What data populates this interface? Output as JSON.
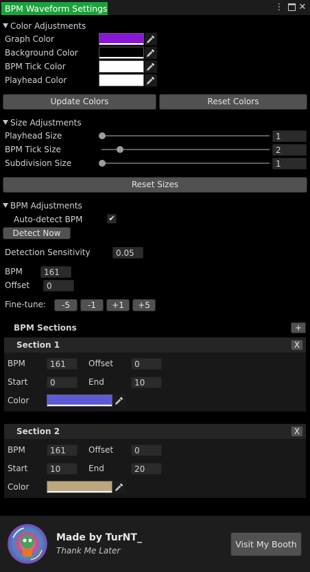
{
  "window": {
    "tab_title": "BPM Waveform Settings",
    "menu_icon": "kebab-menu-icon",
    "maximize_icon": "maximize-icon",
    "close_icon": "close-icon"
  },
  "colors_section": {
    "title": "Color Adjustments",
    "rows": [
      {
        "label": "Graph Color",
        "color": "#8a17d6"
      },
      {
        "label": "Background Color",
        "color": "#000000"
      },
      {
        "label": "BPM Tick Color",
        "color": "#ffffff"
      },
      {
        "label": "Playhead Color",
        "color": "#ffffff"
      }
    ],
    "update_button": "Update Colors",
    "reset_button": "Reset Colors"
  },
  "size_section": {
    "title": "Size Adjustments",
    "rows": [
      {
        "label": "Playhead Size",
        "value": "1",
        "fraction": 0.0
      },
      {
        "label": "BPM Tick Size",
        "value": "2",
        "fraction": 0.11
      },
      {
        "label": "Subdivision Size",
        "value": "1",
        "fraction": 0.0
      }
    ],
    "reset_button": "Reset Sizes"
  },
  "bpm_section": {
    "title": "BPM Adjustments",
    "auto_detect_label": "Auto-detect BPM",
    "auto_detect_checked": true,
    "check_mark": "✔",
    "detect_now_button": "Detect Now",
    "sensitivity_label": "Detection Sensitivity",
    "sensitivity_value": "0.05",
    "bpm_label": "BPM",
    "bpm_value": "161",
    "offset_label": "Offset",
    "offset_value": "0",
    "finetune_label": "Fine-tune:",
    "finetune_buttons": [
      "-5",
      "-1",
      "+1",
      "+5"
    ]
  },
  "sections": {
    "title": "BPM Sections",
    "add_button": "+",
    "items": [
      {
        "title": "Section 1",
        "remove": "X",
        "bpm_label": "BPM",
        "bpm": "161",
        "offset_label": "Offset",
        "offset": "0",
        "start_label": "Start",
        "start": "0",
        "end_label": "End",
        "end": "10",
        "color_label": "Color",
        "color": "#5f5ad4"
      },
      {
        "title": "Section 2",
        "remove": "X",
        "bpm_label": "BPM",
        "bpm": "161",
        "offset_label": "Offset",
        "offset": "0",
        "start_label": "Start",
        "start": "10",
        "end_label": "End",
        "end": "20",
        "color_label": "Color",
        "color": "#bca77e"
      }
    ]
  },
  "footer": {
    "credit": "Made by TurNT_",
    "tagline": "Thank Me Later",
    "booth_button": "Visit My Booth"
  }
}
